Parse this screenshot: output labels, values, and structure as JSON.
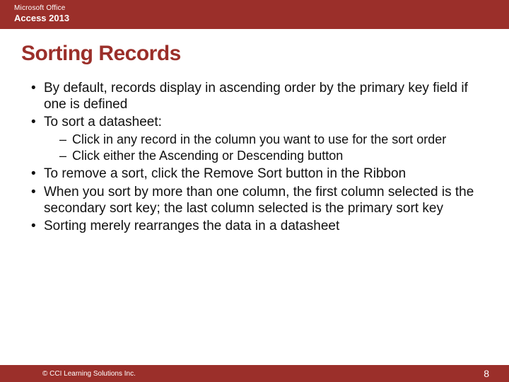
{
  "header": {
    "brand": "Microsoft Office",
    "product": "Access 2013"
  },
  "title": "Sorting Records",
  "bullets": [
    {
      "text": "By default, records display in ascending order by the primary key field if one is defined"
    },
    {
      "text": "To sort a datasheet:",
      "sub": [
        "Click in any record in the column you want to use for the sort order",
        "Click either the Ascending or Descending button"
      ]
    },
    {
      "text": "To remove a sort, click the Remove Sort button in the Ribbon"
    },
    {
      "text": "When you sort by more than one column, the first column selected is the secondary sort key; the last column selected is the primary sort key"
    },
    {
      "text": "Sorting merely rearranges the data in a datasheet"
    }
  ],
  "footer": {
    "copyright": "© CCI Learning Solutions Inc.",
    "page": "8"
  }
}
